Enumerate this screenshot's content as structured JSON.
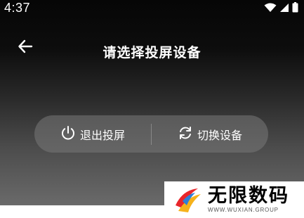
{
  "status_bar": {
    "time": "4:37",
    "icons": [
      "wifi-icon",
      "signal-icon",
      "battery-icon"
    ]
  },
  "header": {
    "back_icon": "arrow-left-icon",
    "title": "请选择投屏设备"
  },
  "actions": {
    "exit": {
      "label": "退出投屏",
      "icon": "power-icon"
    },
    "switch": {
      "label": "切换设备",
      "icon": "refresh-icon"
    }
  },
  "watermark": {
    "title": "无限数码",
    "subtitle": "WWW.WUXIAN.GROUP"
  },
  "colors": {
    "text": "#ffffff",
    "pill_bg": "#787878",
    "logo_red": "#e8262b",
    "logo_yellow": "#f6b21b",
    "logo_blue": "#2f7fd6"
  }
}
